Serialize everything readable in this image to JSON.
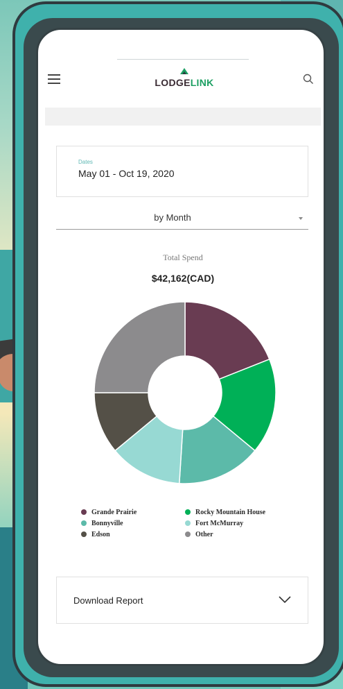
{
  "header": {
    "brand_part1": "LODGE",
    "brand_part2": "LINK"
  },
  "date_card": {
    "label": "Dates",
    "value": "May 01 - Oct 19, 2020"
  },
  "period_select": {
    "value": "by Month"
  },
  "total": {
    "label": "Total Spend",
    "value": "$42,162(CAD)"
  },
  "chart_data": {
    "type": "pie",
    "title": "Total Spend",
    "donut": true,
    "labels": [
      "Grande Prairie",
      "Rocky Mountain House",
      "Fort McMurray",
      "Bonnyville",
      "Edson",
      "Other"
    ],
    "values": [
      19,
      17,
      15,
      13,
      11,
      25
    ],
    "colors": [
      "#693c52",
      "#00b057",
      "#5cbaa9",
      "#97d9d3",
      "#545047",
      "#8c8b8d"
    ]
  },
  "legend": {
    "items": [
      {
        "label": "Grande Prairie",
        "color": "#693c52"
      },
      {
        "label": "Rocky Mountain House",
        "color": "#00b057"
      },
      {
        "label": "Bonnyville",
        "color": "#5cbaa9"
      },
      {
        "label": "Fort McMurray",
        "color": "#97d9d3"
      },
      {
        "label": "Edson",
        "color": "#545047"
      },
      {
        "label": "Other",
        "color": "#8c8b8d"
      }
    ]
  },
  "download": {
    "label": "Download Report"
  },
  "icons": {
    "menu": "menu-icon",
    "search": "search-icon",
    "dropdown": "caret-down-icon",
    "expand": "chevron-down-icon",
    "logo": "lodgelink-logo-icon"
  }
}
